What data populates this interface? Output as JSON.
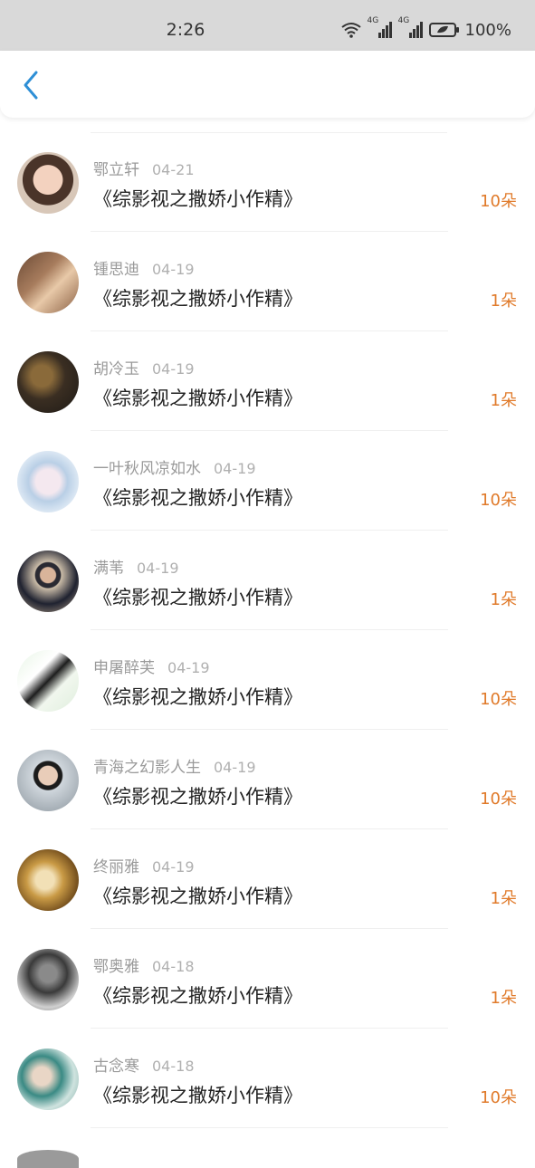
{
  "status": {
    "time": "2:26",
    "network_label_1": "4G",
    "network_label_2": "4G",
    "battery": "100%"
  },
  "nav": {
    "back_icon": "chevron-left-icon",
    "accent": "#2e8fd6"
  },
  "colors": {
    "count": "#e07a2a",
    "name": "#9a9a9a"
  },
  "items": [
    {
      "name": "鄂立轩",
      "date": "04-21",
      "title": "《综影视之撒娇小作精》",
      "count": "10朵"
    },
    {
      "name": "锺思迪",
      "date": "04-19",
      "title": "《综影视之撒娇小作精》",
      "count": "1朵"
    },
    {
      "name": "胡冷玉",
      "date": "04-19",
      "title": "《综影视之撒娇小作精》",
      "count": "1朵"
    },
    {
      "name": "一叶秋风凉如水",
      "date": "04-19",
      "title": "《综影视之撒娇小作精》",
      "count": "10朵"
    },
    {
      "name": "满苇",
      "date": "04-19",
      "title": "《综影视之撒娇小作精》",
      "count": "1朵"
    },
    {
      "name": "申屠醉芙",
      "date": "04-19",
      "title": "《综影视之撒娇小作精》",
      "count": "10朵"
    },
    {
      "name": "青海之幻影人生",
      "date": "04-19",
      "title": "《综影视之撒娇小作精》",
      "count": "10朵"
    },
    {
      "name": "终丽雅",
      "date": "04-19",
      "title": "《综影视之撒娇小作精》",
      "count": "1朵"
    },
    {
      "name": "鄂奥雅",
      "date": "04-18",
      "title": "《综影视之撒娇小作精》",
      "count": "1朵"
    },
    {
      "name": "古念寒",
      "date": "04-18",
      "title": "《综影视之撒娇小作精》",
      "count": "10朵"
    }
  ]
}
